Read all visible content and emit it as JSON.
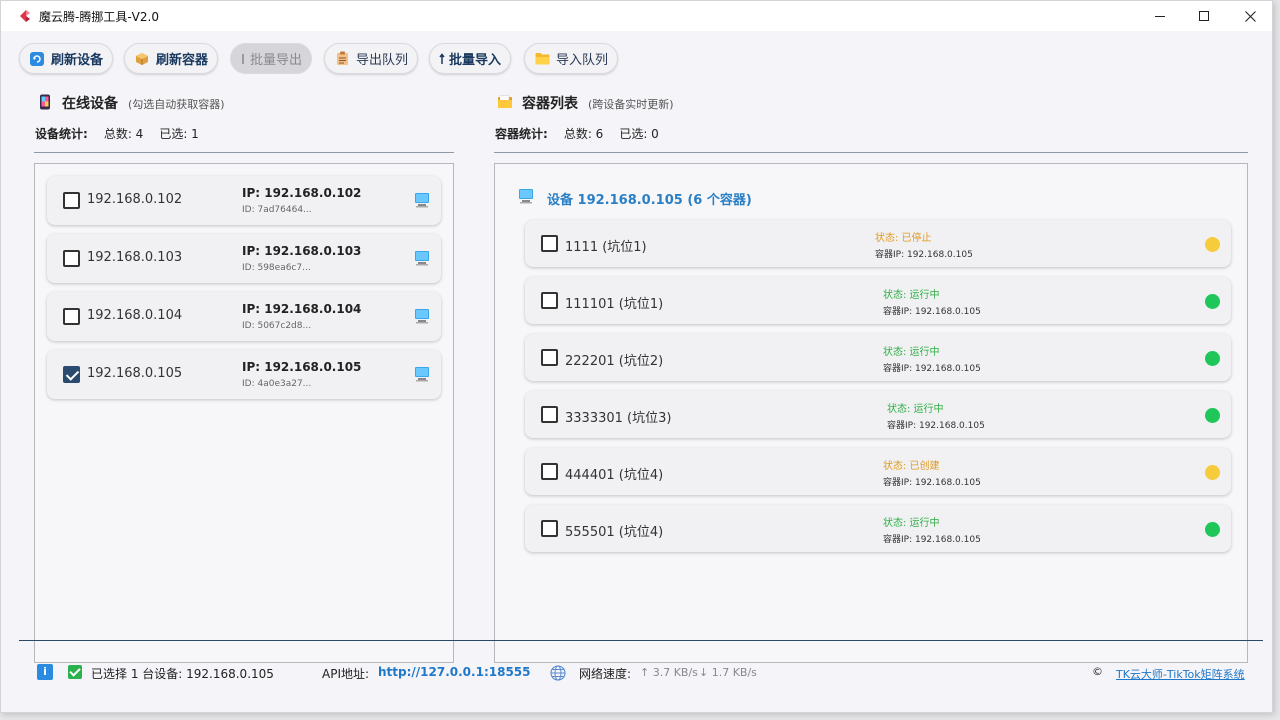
{
  "window": {
    "title": "魔云腾-腾挪工具-V2.0"
  },
  "toolbar": {
    "buttons": [
      {
        "label": "刷新设备",
        "icon": "refresh-icon"
      },
      {
        "label": "刷新容器",
        "icon": "box-icon"
      },
      {
        "label": "批量导出",
        "icon": "export-icon"
      },
      {
        "label": "导出队列",
        "icon": "clipboard-icon"
      },
      {
        "label": "批量导入",
        "icon": "import-icon"
      },
      {
        "label": "导入队列",
        "icon": "folder-icon"
      }
    ]
  },
  "devices": {
    "title": "在线设备",
    "subtitle": "(勾选自动获取容器)",
    "stats_label": "设备统计:",
    "total": "总数: 4",
    "selected": "已选: 1",
    "items": [
      {
        "name": "192.168.0.102",
        "ip": "IP: 192.168.0.102",
        "id": "ID: 7ad76464...",
        "checked": false
      },
      {
        "name": "192.168.0.103",
        "ip": "IP: 192.168.0.103",
        "id": "ID: 598ea6c7...",
        "checked": false
      },
      {
        "name": "192.168.0.104",
        "ip": "IP: 192.168.0.104",
        "id": "ID: 5067c2d8...",
        "checked": false
      },
      {
        "name": "192.168.0.105",
        "ip": "IP: 192.168.0.105",
        "id": "ID: 4a0e3a27...",
        "checked": true
      }
    ]
  },
  "containers": {
    "title": "容器列表",
    "subtitle": "(跨设备实时更新)",
    "stats_label": "容器统计:",
    "total": "总数: 6",
    "selected": "已选: 0",
    "group_title": "设备 192.168.0.105 (6 个容器)",
    "items": [
      {
        "name": "1111 (坑位1)",
        "status": "状态: 已停止",
        "ip": "容器IP: 192.168.0.105",
        "state": "stopped"
      },
      {
        "name": "111101 (坑位1)",
        "status": "状态: 运行中",
        "ip": "容器IP: 192.168.0.105",
        "state": "running"
      },
      {
        "name": "222201 (坑位2)",
        "status": "状态: 运行中",
        "ip": "容器IP: 192.168.0.105",
        "state": "running"
      },
      {
        "name": "3333301 (坑位3)",
        "status": "状态: 运行中",
        "ip": "容器IP: 192.168.0.105",
        "state": "running"
      },
      {
        "name": "444401 (坑位4)",
        "status": "状态: 已创建",
        "ip": "容器IP: 192.168.0.105",
        "state": "created"
      },
      {
        "name": "555501 (坑位4)",
        "status": "状态: 运行中",
        "ip": "容器IP: 192.168.0.105",
        "state": "running"
      }
    ]
  },
  "colors": {
    "running_text": "#2fae44",
    "running_dot": "#1fc65a",
    "stopped_text": "#e09a20",
    "stopped_dot": "#f6cb3c",
    "accent": "#2a7fc4"
  },
  "statusbar": {
    "selection": "已选择 1 台设备: 192.168.0.105",
    "api_label": "API地址:",
    "api_url": "http://127.0.0.1:18555",
    "net_label": "网络速度:",
    "net_up": "↑ 3.7 KB/s",
    "net_down": "↓ 1.7 KB/s",
    "copyright_symbol": "©",
    "copyright_text": "TK云大师-TikTok矩阵系统"
  }
}
